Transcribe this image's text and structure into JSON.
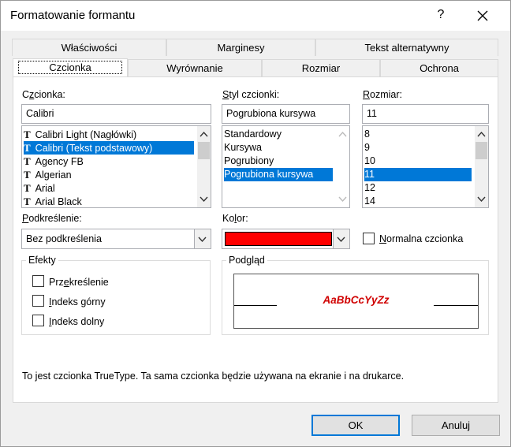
{
  "window": {
    "title": "Formatowanie formantu",
    "help_label": "?"
  },
  "tabs_back": [
    {
      "label": "Właściwości"
    },
    {
      "label": "Marginesy"
    },
    {
      "label": "Tekst alternatywny"
    }
  ],
  "tabs_front": [
    {
      "label": "Czcionka"
    },
    {
      "label": "Wyrównanie"
    },
    {
      "label": "Rozmiar"
    },
    {
      "label": "Ochrona"
    }
  ],
  "font": {
    "label": "Czcionka:",
    "label_hotkey": "z",
    "label_rest": "cionka:",
    "label_first": "C",
    "value": "Calibri",
    "items": [
      {
        "label": "Calibri Light (Nagłówki)"
      },
      {
        "label": "Calibri (Tekst podstawowy)"
      },
      {
        "label": "Agency FB"
      },
      {
        "label": "Algerian"
      },
      {
        "label": "Arial"
      },
      {
        "label": "Arial Black"
      }
    ],
    "selected_index": 1
  },
  "style": {
    "label_hotkey": "S",
    "label_rest": "tyl czcionki:",
    "value": "Pogrubiona kursywa",
    "items": [
      {
        "label": "Standardowy"
      },
      {
        "label": "Kursywa"
      },
      {
        "label": "Pogrubiony"
      },
      {
        "label": "Pogrubiona kursywa"
      }
    ],
    "selected_index": 3
  },
  "size": {
    "label_hotkey": "R",
    "label_rest": "ozmiar:",
    "value": "11",
    "items": [
      {
        "label": "8"
      },
      {
        "label": "9"
      },
      {
        "label": "10"
      },
      {
        "label": "11"
      },
      {
        "label": "12"
      },
      {
        "label": "14"
      }
    ],
    "selected_index": 3
  },
  "underline": {
    "label_hotkey": "P",
    "label_rest": "odkreślenie:",
    "value": "Bez podkreślenia"
  },
  "color": {
    "label_pre": "Ko",
    "label_hotkey": "l",
    "label_rest": "or:",
    "value": "#ff0000"
  },
  "normal_font": {
    "label_hotkey": "N",
    "label_rest": "ormalna czcionka",
    "checked": false
  },
  "effects": {
    "title": "Efekty",
    "items": [
      {
        "pre": "Prz",
        "hotkey": "e",
        "rest": "kreślenie",
        "checked": false
      },
      {
        "pre": "",
        "hotkey": "I",
        "rest": "ndeks górny",
        "checked": false
      },
      {
        "pre": "",
        "hotkey": "I",
        "rest": "ndeks dolny",
        "checked": false
      }
    ]
  },
  "preview": {
    "title": "Podgląd",
    "sample": "AaBbCcYyZz",
    "sample_color": "#d00000"
  },
  "info": "To jest czcionka TrueType. Ta sama czcionka będzie używana na ekranie i na drukarce.",
  "buttons": {
    "ok": "OK",
    "cancel": "Anuluj"
  },
  "colors": {
    "accent": "#0078d7",
    "dialog_bg": "#f0f0f0"
  }
}
